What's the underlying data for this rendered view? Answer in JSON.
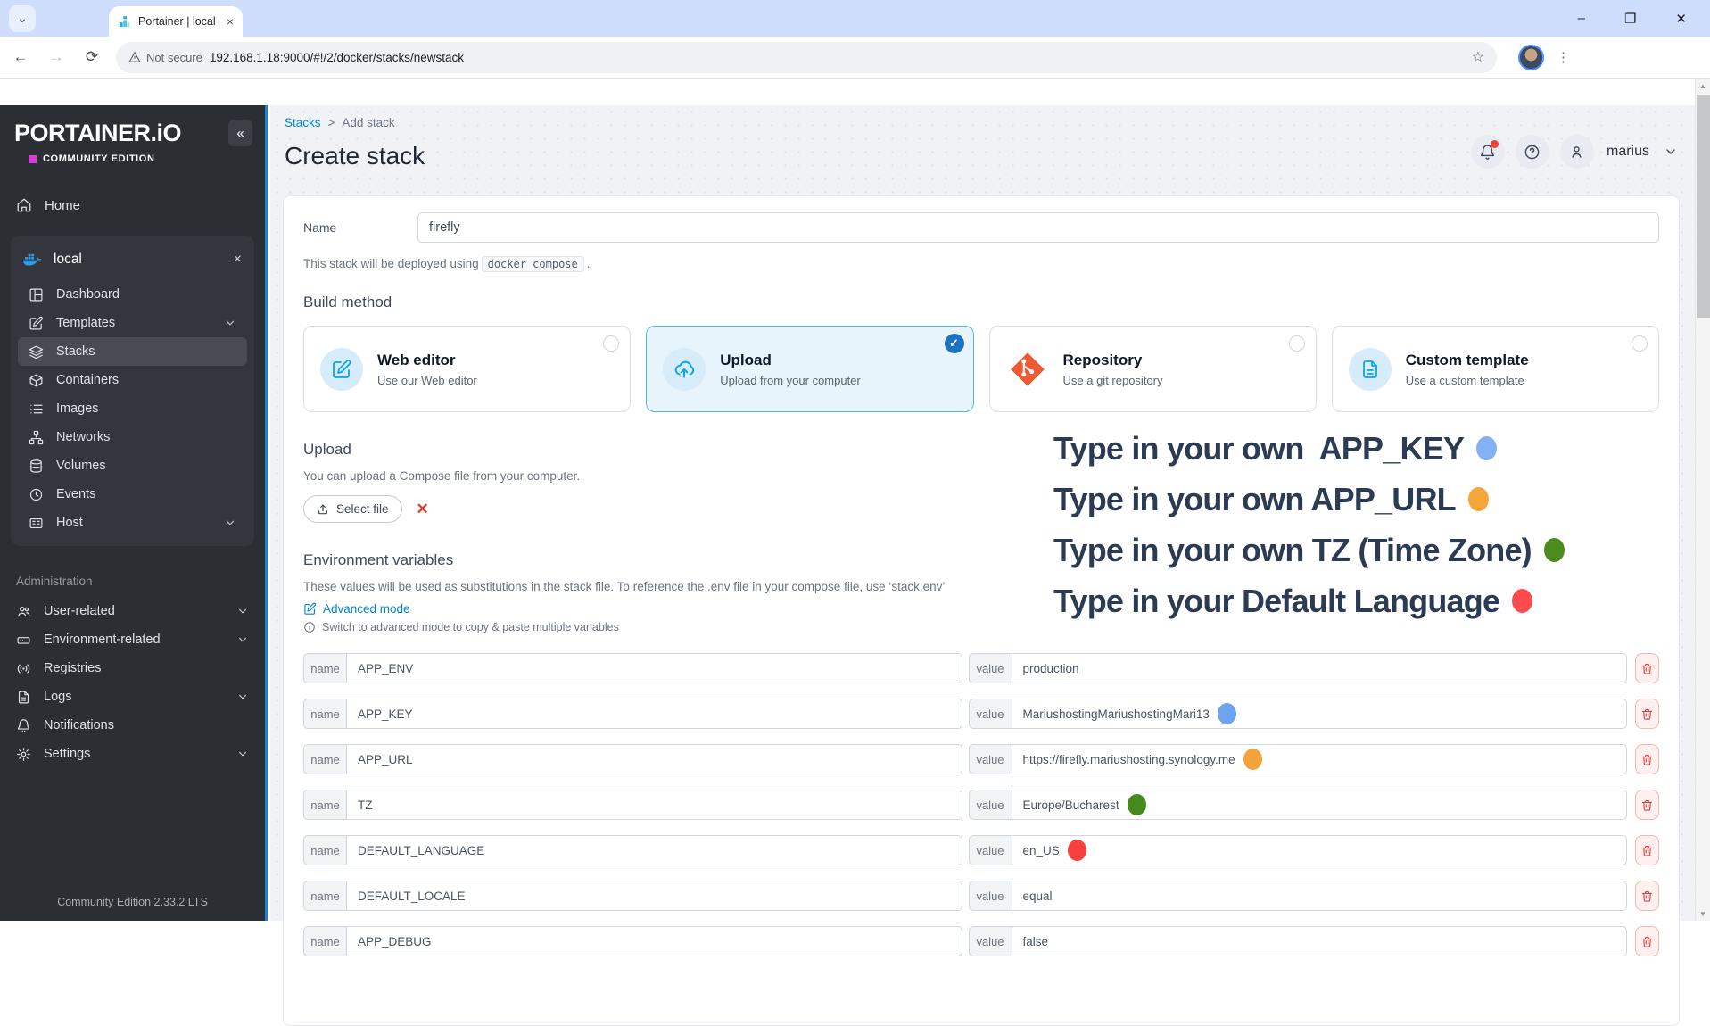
{
  "browser": {
    "tab_title": "Portainer | local",
    "tab_close_glyph": "×",
    "security_label": "Not secure",
    "url": "192.168.1.18:9000/#!/2/docker/stacks/newstack",
    "window": {
      "minimize": "–",
      "restore": "❐",
      "close": "✕"
    }
  },
  "sidebar": {
    "logo_text": "PORTAINER.iO",
    "edition": "COMMUNITY EDITION",
    "collapse_glyph": "«",
    "home_label": "Home",
    "environment_name": "local",
    "env_close_glyph": "×",
    "items": {
      "dashboard": "Dashboard",
      "templates": "Templates",
      "stacks": "Stacks",
      "containers": "Containers",
      "images": "Images",
      "networks": "Networks",
      "volumes": "Volumes",
      "events": "Events",
      "host": "Host"
    },
    "admin_label": "Administration",
    "admin": {
      "user_related": "User-related",
      "environment_related": "Environment-related",
      "registries": "Registries",
      "logs": "Logs",
      "notifications": "Notifications",
      "settings": "Settings"
    },
    "footer": "Community Edition 2.33.2 LTS"
  },
  "header": {
    "breadcrumb_root": "Stacks",
    "breadcrumb_sep": ">",
    "breadcrumb_current": "Add stack",
    "title": "Create stack",
    "username": "marius"
  },
  "form": {
    "name_label": "Name",
    "name_value": "firefly",
    "deploy_prefix": "This stack will be deployed using",
    "deploy_code": "docker compose",
    "deploy_suffix": ".",
    "build_method_label": "Build method",
    "methods": [
      {
        "title": "Web editor",
        "subtitle": "Use our Web editor",
        "selected": false
      },
      {
        "title": "Upload",
        "subtitle": "Upload from your computer",
        "selected": true
      },
      {
        "title": "Repository",
        "subtitle": "Use a git repository",
        "selected": false
      },
      {
        "title": "Custom template",
        "subtitle": "Use a custom template",
        "selected": false
      }
    ],
    "upload_title": "Upload",
    "upload_desc": "You can upload a Compose file from your computer.",
    "select_file_label": "Select file",
    "env_title": "Environment variables",
    "env_desc": "These values will be used as substitutions in the stack file. To reference the .env file in your compose file, use ‘stack.env’",
    "advanced_mode_label": "Advanced mode",
    "switch_note": "Switch to advanced mode to copy & paste multiple variables",
    "name_chip": "name",
    "value_chip": "value",
    "vars": [
      {
        "name": "APP_ENV",
        "value": "production",
        "dot": null
      },
      {
        "name": "APP_KEY",
        "value": "MariushostingMariushostingMari13",
        "dot": "#6ea3ee"
      },
      {
        "name": "APP_URL",
        "value": "https://firefly.mariushosting.synology.me",
        "dot": "#f3a33c"
      },
      {
        "name": "TZ",
        "value": "Europe/Bucharest",
        "dot": "#468a1d"
      },
      {
        "name": "DEFAULT_LANGUAGE",
        "value": "en_US",
        "dot": "#f8413e"
      },
      {
        "name": "DEFAULT_LOCALE",
        "value": "equal",
        "dot": null
      },
      {
        "name": "APP_DEBUG",
        "value": "false",
        "dot": null
      }
    ]
  },
  "annotations": [
    {
      "text": "Type in your own  APP_KEY",
      "dot": "#84b1f4"
    },
    {
      "text": "Type in your own APP_URL",
      "dot": "#f5a73b"
    },
    {
      "text": "Type in your own TZ (Time Zone)",
      "dot": "#4a8c1e"
    },
    {
      "text": "Type in your Default Language",
      "dot": "#fb4b4d"
    }
  ]
}
